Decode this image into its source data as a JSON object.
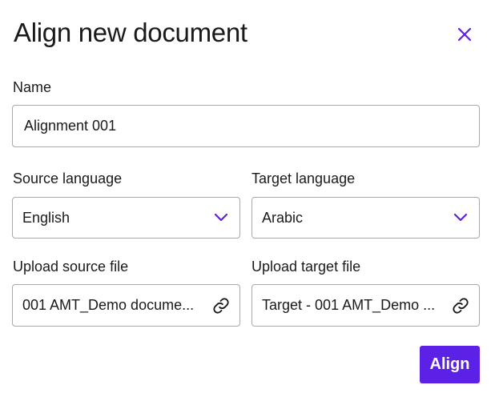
{
  "dialog": {
    "title": "Align new document",
    "close_icon": "close-icon",
    "accent_color": "#5b21e6"
  },
  "name_field": {
    "label": "Name",
    "value": "Alignment 001"
  },
  "source_language": {
    "label": "Source language",
    "selected": "English",
    "icon": "chevron-down-icon"
  },
  "target_language": {
    "label": "Target language",
    "selected": "Arabic",
    "icon": "chevron-down-icon"
  },
  "source_file": {
    "label": "Upload source file",
    "value": "001 AMT_Demo docume...",
    "icon": "link-icon"
  },
  "target_file": {
    "label": "Upload target file",
    "value": "Target - 001 AMT_Demo ...",
    "icon": "link-icon"
  },
  "actions": {
    "align_label": "Align"
  }
}
